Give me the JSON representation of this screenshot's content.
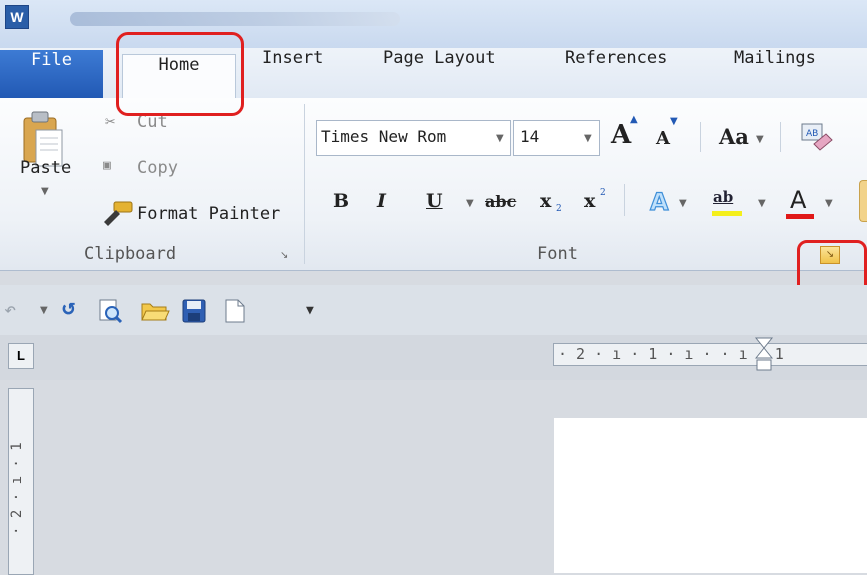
{
  "app": {
    "icon_letter": "W"
  },
  "tabs": {
    "file": "File",
    "home": "Home",
    "insert": "Insert",
    "page_layout": "Page Layout",
    "references": "References",
    "mailings": "Mailings"
  },
  "clipboard": {
    "paste": "Paste",
    "cut": "Cut",
    "copy": "Copy",
    "format_painter": "Format Painter",
    "group_label": "Clipboard"
  },
  "font": {
    "font_name": "Times New Rom",
    "font_size": "14",
    "grow": "A",
    "shrink": "A",
    "change_case": "Aa",
    "bold": "B",
    "italic": "I",
    "underline": "U",
    "strikethrough": "abc",
    "subscript": "x",
    "superscript": "x",
    "highlight": "ab",
    "font_color": "A",
    "group_label": "Font"
  },
  "ruler": {
    "text": "· 2 · ı · 1 · ı ·   · ı · 1"
  },
  "vruler": {
    "text": "· 2 · ı · 1"
  },
  "colors": {
    "accent": "#2259b4",
    "highlight": "#e02020"
  }
}
